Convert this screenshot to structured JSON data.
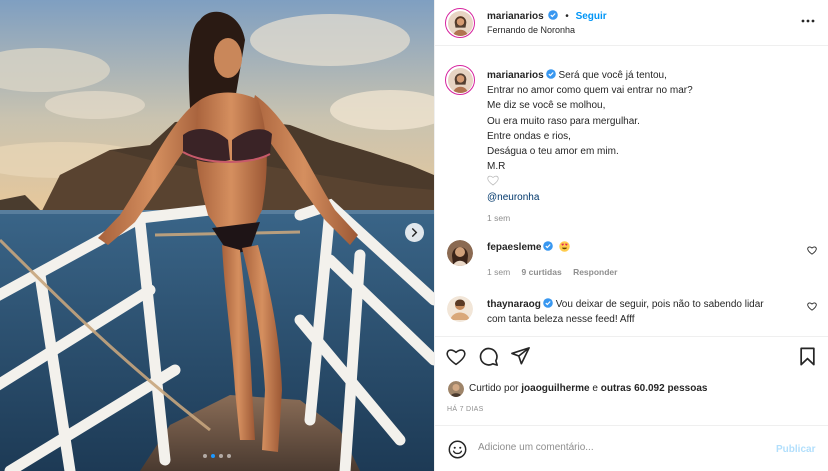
{
  "post": {
    "author": {
      "username": "marianarios",
      "verified": true,
      "follow_label": "Seguir",
      "location": "Fernando de Noronha"
    },
    "more_options_icon": "more-horizontal-icon",
    "caption": {
      "username": "marianarios",
      "lines": [
        "Será que você já tentou,",
        "Entrar no amor como quem vai entrar no mar?",
        "Me diz se você se molhou,",
        "Ou era muito raso para mergulhar.",
        "Entre ondas e rios,",
        "Deságua o teu amor em mim.",
        "M.R"
      ],
      "heart_icon": "white-heart-emoji",
      "mention": "@neuronha",
      "time": "1 sem"
    },
    "comments": [
      {
        "username": "fepaesleme",
        "verified": true,
        "text": "",
        "emoji": "heart-eyes-emoji",
        "time": "1 sem",
        "likes": "9 curtidas",
        "reply_label": "Responder"
      },
      {
        "username": "thaynaraog",
        "verified": true,
        "text_line1": "Vou deixar de seguir, pois não to sabendo lidar",
        "text_line2": "com tanta beleza nesse feed! Afff"
      }
    ],
    "actions": {
      "like_icon": "heart-outline-icon",
      "comment_icon": "comment-icon",
      "share_icon": "paper-plane-icon",
      "save_icon": "bookmark-icon"
    },
    "likes": {
      "prefix": "Curtido por",
      "user": "joaoguilherme",
      "middle": "e",
      "others": "outras 60.092 pessoas"
    },
    "posted_ago": "HÁ 7 DIAS",
    "comment_box": {
      "placeholder": "Adicione um comentário...",
      "publish_label": "Publicar"
    },
    "carousel": {
      "slide_count": 4,
      "active_index": 1
    },
    "colors": {
      "accent": "#0095f6",
      "verified": "#3897f0",
      "publish_disabled": "#b2dffc",
      "story_ring": "#d6249f"
    }
  }
}
